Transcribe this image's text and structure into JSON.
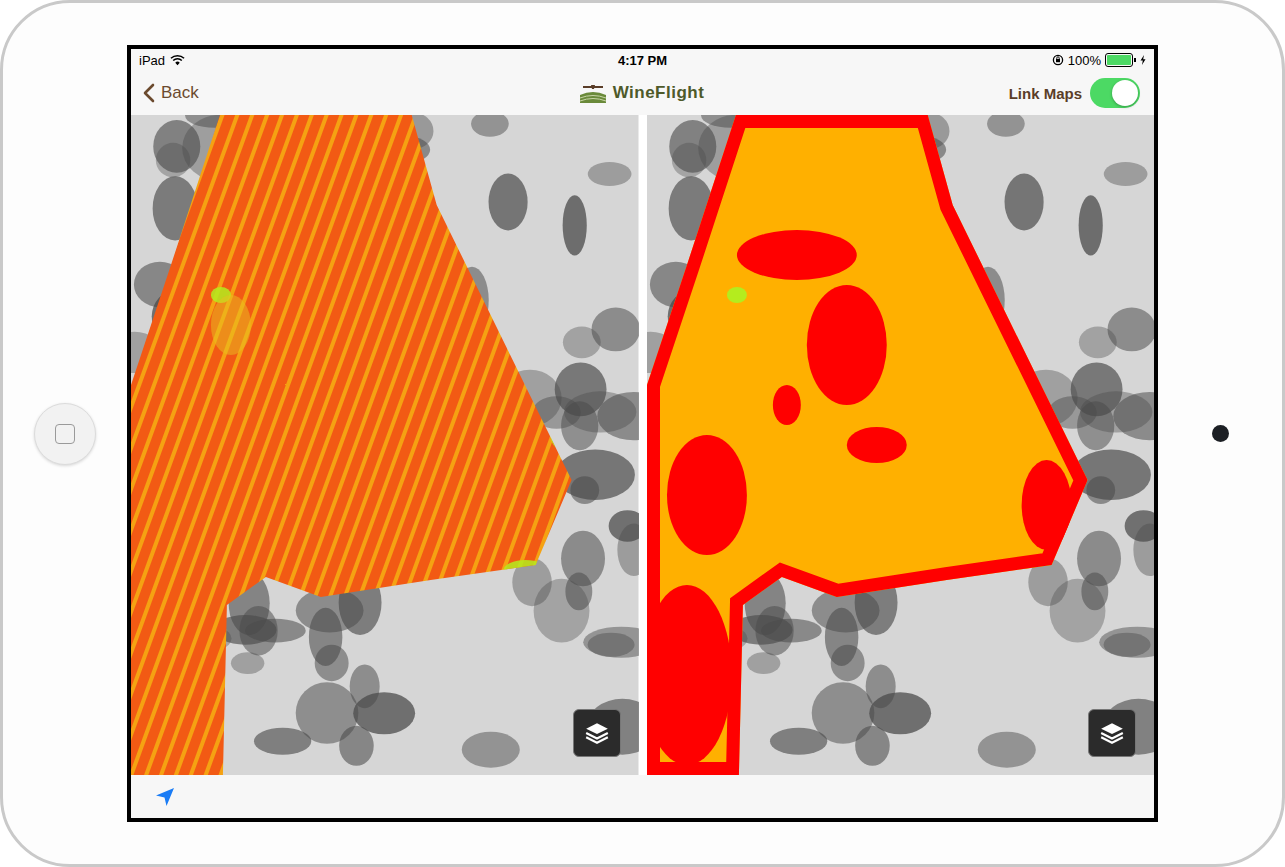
{
  "status_bar": {
    "carrier": "iPad",
    "time": "4:17 PM",
    "battery": "100%",
    "battery_level": 1.0,
    "charging": true
  },
  "nav_bar": {
    "back": "Back",
    "title": "WineFlight",
    "link_maps": {
      "label": "Link Maps",
      "on": true
    }
  },
  "maps": [
    {
      "kind": "continuous"
    },
    {
      "kind": "classified"
    }
  ]
}
